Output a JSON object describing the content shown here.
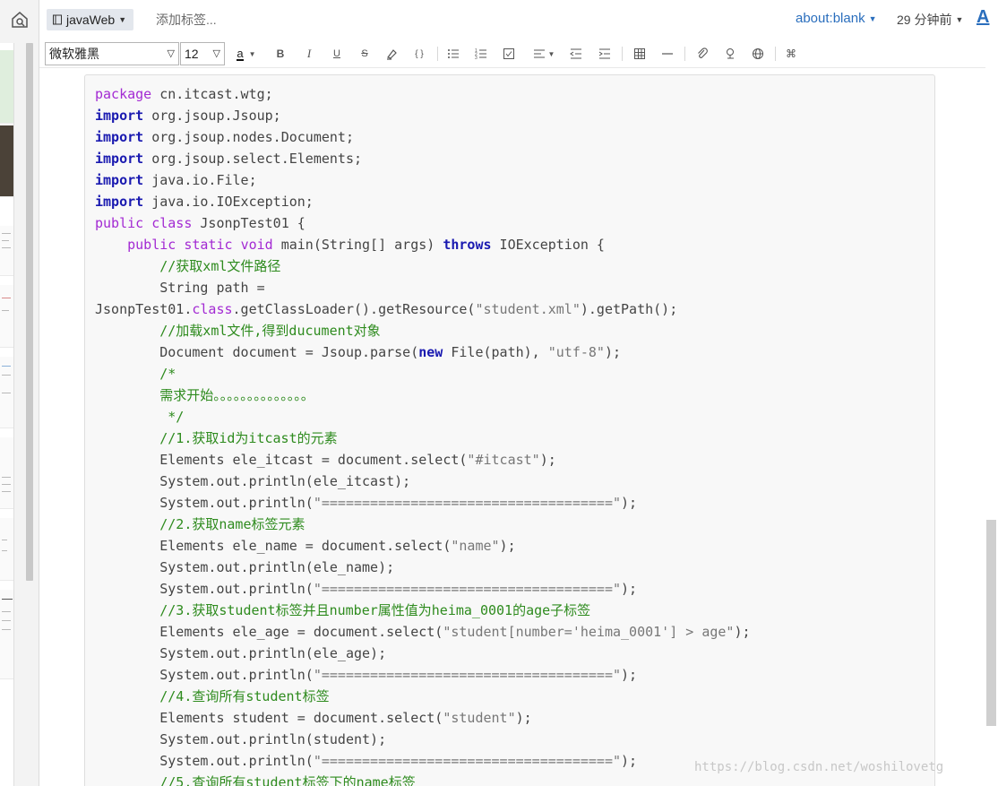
{
  "header": {
    "notebook": "javaWeb",
    "add_tag_placeholder": "添加标签...",
    "source_link": "about:blank",
    "time_ago": "29 分钟前",
    "font_button": "A"
  },
  "toolbar": {
    "font_family": "微软雅黑",
    "font_size": "12",
    "bold": "B",
    "italic": "I",
    "underline": "U",
    "strike": "S",
    "code": "{ }",
    "command": "⌘"
  },
  "code_lines": [
    [
      {
        "t": "package",
        "c": "kw-p"
      },
      {
        "t": " cn.itcast.wtg;"
      }
    ],
    [
      {
        "t": "import",
        "c": "kw-b"
      },
      {
        "t": " org.jsoup.Jsoup;"
      }
    ],
    [
      {
        "t": "import",
        "c": "kw-b"
      },
      {
        "t": " org.jsoup.nodes.Document;"
      }
    ],
    [
      {
        "t": "import",
        "c": "kw-b"
      },
      {
        "t": " org.jsoup.select.Elements;"
      }
    ],
    [
      {
        "t": "import",
        "c": "kw-b"
      },
      {
        "t": " java.io.File;"
      }
    ],
    [
      {
        "t": "import",
        "c": "kw-b"
      },
      {
        "t": " java.io.IOException;"
      }
    ],
    [
      {
        "t": "public",
        "c": "kw-p"
      },
      {
        "t": " "
      },
      {
        "t": "class",
        "c": "kw-p"
      },
      {
        "t": " JsonpTest01 {"
      }
    ],
    [
      {
        "t": "    "
      },
      {
        "t": "public",
        "c": "kw-p"
      },
      {
        "t": " "
      },
      {
        "t": "static",
        "c": "kw-p"
      },
      {
        "t": " "
      },
      {
        "t": "void",
        "c": "kw-p"
      },
      {
        "t": " main(String[] args) "
      },
      {
        "t": "throws",
        "c": "kw-b"
      },
      {
        "t": " IOException {"
      }
    ],
    [
      {
        "t": "        "
      },
      {
        "t": "//获取xml文件路径",
        "c": "cm"
      }
    ],
    [
      {
        "t": "        String path ="
      }
    ],
    [
      {
        "t": "JsonpTest01."
      },
      {
        "t": "class",
        "c": "kw-p"
      },
      {
        "t": ".getClassLoader().getResource("
      },
      {
        "t": "\"student.xml\"",
        "c": "str"
      },
      {
        "t": ").getPath();"
      }
    ],
    [
      {
        "t": "        "
      },
      {
        "t": "//加载xml文件,得到ducument对象",
        "c": "cm"
      }
    ],
    [
      {
        "t": "        Document document = Jsoup.parse("
      },
      {
        "t": "new",
        "c": "kw-b"
      },
      {
        "t": " File(path), "
      },
      {
        "t": "\"utf-8\"",
        "c": "str"
      },
      {
        "t": ");"
      }
    ],
    [
      {
        "t": "        "
      },
      {
        "t": "/*",
        "c": "cm"
      }
    ],
    [
      {
        "t": "        "
      },
      {
        "t": "需求开始。。。。。。。。。。。。。。",
        "c": "cm"
      }
    ],
    [
      {
        "t": "         "
      },
      {
        "t": "*/",
        "c": "cm"
      }
    ],
    [
      {
        "t": "        "
      },
      {
        "t": "//1.获取id为itcast的元素",
        "c": "cm"
      }
    ],
    [
      {
        "t": "        Elements ele_itcast = document.select("
      },
      {
        "t": "\"#itcast\"",
        "c": "str"
      },
      {
        "t": ");"
      }
    ],
    [
      {
        "t": "        System.out.println(ele_itcast);"
      }
    ],
    [
      {
        "t": "        System.out.println("
      },
      {
        "t": "\"====================================\"",
        "c": "str"
      },
      {
        "t": ");"
      }
    ],
    [
      {
        "t": "        "
      },
      {
        "t": "//2.获取name标签元素",
        "c": "cm"
      }
    ],
    [
      {
        "t": "        Elements ele_name = document.select("
      },
      {
        "t": "\"name\"",
        "c": "str"
      },
      {
        "t": ");"
      }
    ],
    [
      {
        "t": "        System.out.println(ele_name);"
      }
    ],
    [
      {
        "t": "        System.out.println("
      },
      {
        "t": "\"====================================\"",
        "c": "str"
      },
      {
        "t": ");"
      }
    ],
    [
      {
        "t": "        "
      },
      {
        "t": "//3.获取student标签并且number属性值为heima_0001的age子标签",
        "c": "cm"
      }
    ],
    [
      {
        "t": "        Elements ele_age = document.select("
      },
      {
        "t": "\"student[number='heima_0001'] > age\"",
        "c": "str"
      },
      {
        "t": ");"
      }
    ],
    [
      {
        "t": "        System.out.println(ele_age);"
      }
    ],
    [
      {
        "t": "        System.out.println("
      },
      {
        "t": "\"====================================\"",
        "c": "str"
      },
      {
        "t": ");"
      }
    ],
    [
      {
        "t": "        "
      },
      {
        "t": "//4.查询所有student标签",
        "c": "cm"
      }
    ],
    [
      {
        "t": "        Elements student = document.select("
      },
      {
        "t": "\"student\"",
        "c": "str"
      },
      {
        "t": ");"
      }
    ],
    [
      {
        "t": "        System.out.println(student);"
      }
    ],
    [
      {
        "t": "        System.out.println("
      },
      {
        "t": "\"====================================\"",
        "c": "str"
      },
      {
        "t": ");"
      }
    ],
    [
      {
        "t": "        "
      },
      {
        "t": "//5.查询所有student标签下的name标签",
        "c": "cm"
      }
    ]
  ],
  "watermark": "https://blog.csdn.net/woshilovetg"
}
